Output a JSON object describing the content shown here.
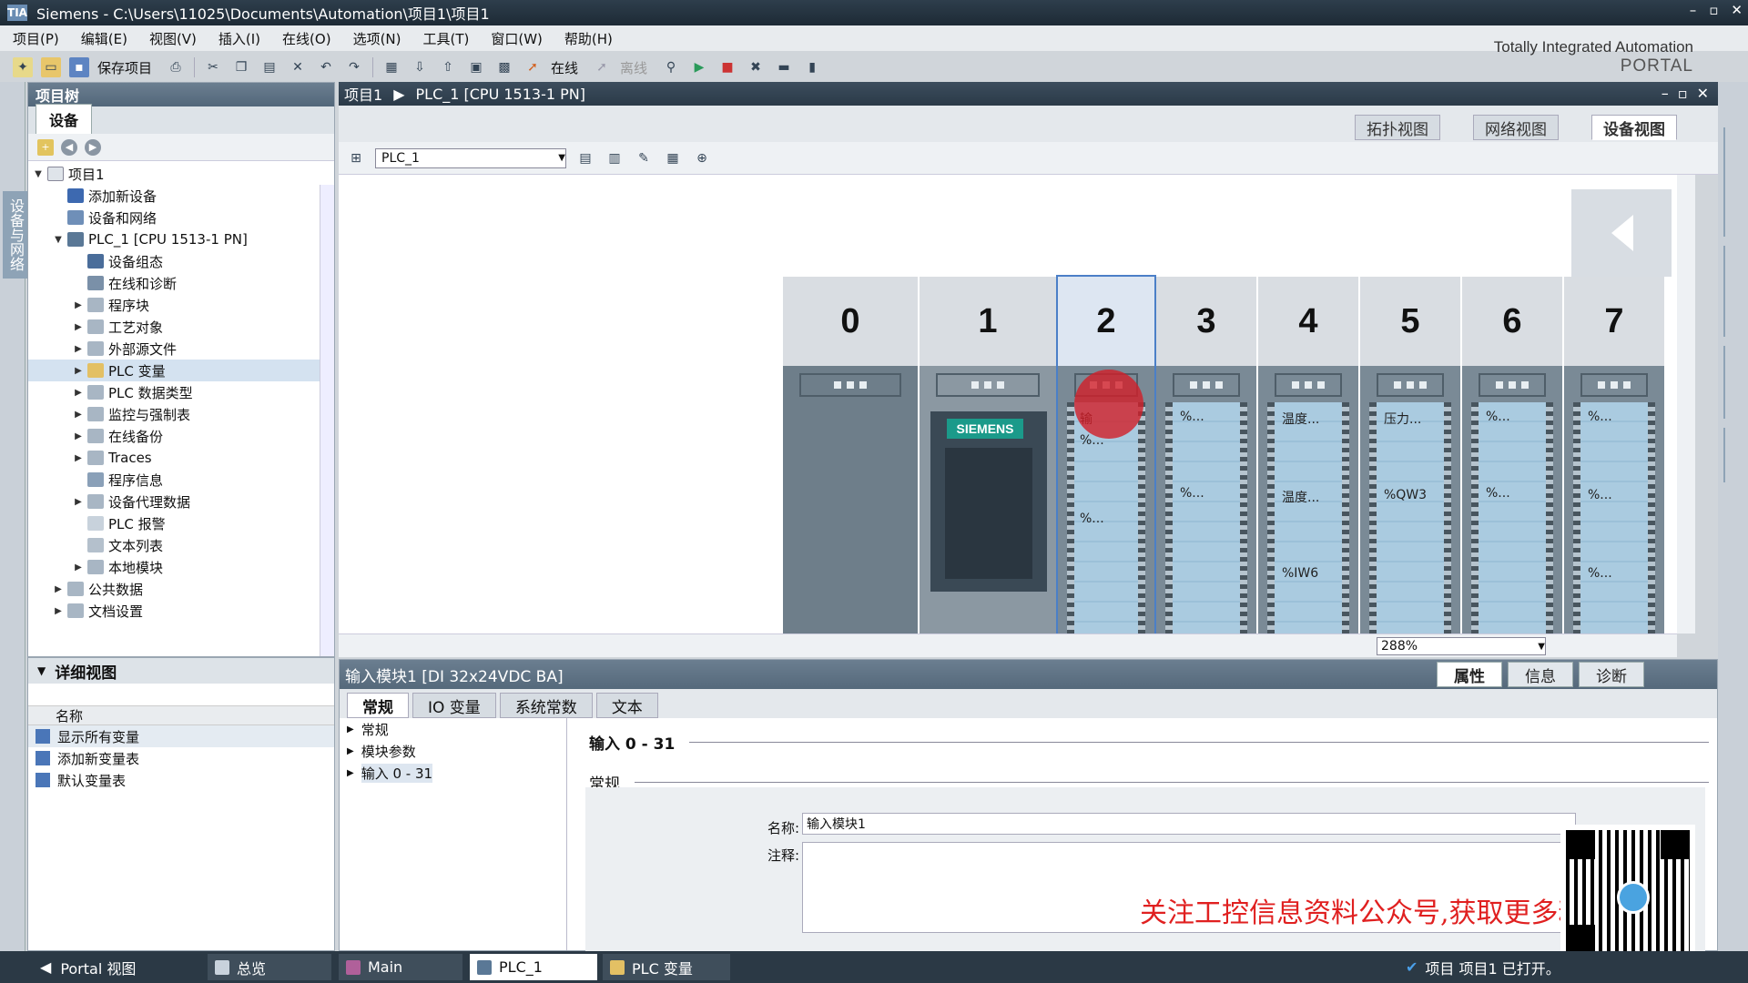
{
  "app": {
    "logo": "TIA",
    "title": "Siemens  -  C:\\Users\\11025\\Documents\\Automation\\项目1\\项目1",
    "win_controls": [
      "–",
      "▫",
      "✕"
    ]
  },
  "menu": [
    "项目(P)",
    "编辑(E)",
    "视图(V)",
    "插入(I)",
    "在线(O)",
    "选项(N)",
    "工具(T)",
    "窗口(W)",
    "帮助(H)"
  ],
  "brand": {
    "line1": "Totally Integrated Automation",
    "line2": "PORTAL"
  },
  "toolbar": {
    "save_label": "保存项目",
    "online_label": "在线",
    "offline_label": "离线"
  },
  "side_tab": "设备与网络",
  "project_tree": {
    "header": "项目树",
    "tab": "设备",
    "items": [
      {
        "label": "项目1",
        "expander": "▼"
      },
      {
        "label": "添加新设备",
        "expander": ""
      },
      {
        "label": "设备和网络",
        "expander": ""
      },
      {
        "label": "PLC_1 [CPU 1513-1 PN]",
        "expander": "▼"
      },
      {
        "label": "设备组态",
        "expander": ""
      },
      {
        "label": "在线和诊断",
        "expander": ""
      },
      {
        "label": "程序块",
        "expander": "▶"
      },
      {
        "label": "工艺对象",
        "expander": "▶"
      },
      {
        "label": "外部源文件",
        "expander": "▶"
      },
      {
        "label": "PLC 变量",
        "expander": "▶"
      },
      {
        "label": "PLC 数据类型",
        "expander": "▶"
      },
      {
        "label": "监控与强制表",
        "expander": "▶"
      },
      {
        "label": "在线备份",
        "expander": "▶"
      },
      {
        "label": "Traces",
        "expander": "▶"
      },
      {
        "label": "程序信息",
        "expander": ""
      },
      {
        "label": "设备代理数据",
        "expander": "▶"
      },
      {
        "label": "PLC 报警",
        "expander": ""
      },
      {
        "label": "文本列表",
        "expander": ""
      },
      {
        "label": "本地模块",
        "expander": "▶"
      },
      {
        "label": "公共数据",
        "expander": "▶"
      },
      {
        "label": "文档设置",
        "expander": "▶"
      }
    ]
  },
  "detail_view": {
    "header": "详细视图",
    "col_name": "名称",
    "rows": [
      "显示所有变量",
      "添加新变量表",
      "默认变量表"
    ]
  },
  "editor": {
    "breadcrumb_project": "项目1",
    "breadcrumb_device": "PLC_1 [CPU 1513-1 PN]",
    "view_tabs": [
      "拓扑视图",
      "网络视图",
      "设备视图"
    ],
    "device_select": "PLC_1",
    "zoom": "288%"
  },
  "rack": {
    "slots": [
      "0",
      "1",
      "2",
      "3",
      "4",
      "5",
      "6",
      "7"
    ],
    "cpu_brand": "SIEMENS",
    "labels": {
      "s2_1": "输",
      "s2_2": "%...",
      "s4_1": "温度...",
      "s4_2": "温度...",
      "s4_3": "%IW6",
      "s5_1": "压力...",
      "s5_2": "%QW3",
      "s3": "%...",
      "s7_1": "%...",
      "s7_2": "%..."
    }
  },
  "inspector": {
    "title": "输入模块1 [DI 32x24VDC BA]",
    "right_tabs": [
      "属性",
      "信息",
      "诊断"
    ],
    "tabs": [
      "常规",
      "IO 变量",
      "系统常数",
      "文本"
    ],
    "nav": [
      "常规",
      "模块参数",
      "输入 0 - 31"
    ],
    "section1": "输入 0 - 31",
    "section2": "常规",
    "name_label": "名称:",
    "name_value": "输入模块1",
    "comment_label": "注释:"
  },
  "watermark": "关注工控信息资料公众号,获取更多精彩!",
  "statusbar": {
    "portal": "Portal 视图",
    "tasks": [
      "总览",
      "Main",
      "PLC_1",
      "PLC 变量"
    ],
    "status": "项目 项目1 已打开。"
  }
}
